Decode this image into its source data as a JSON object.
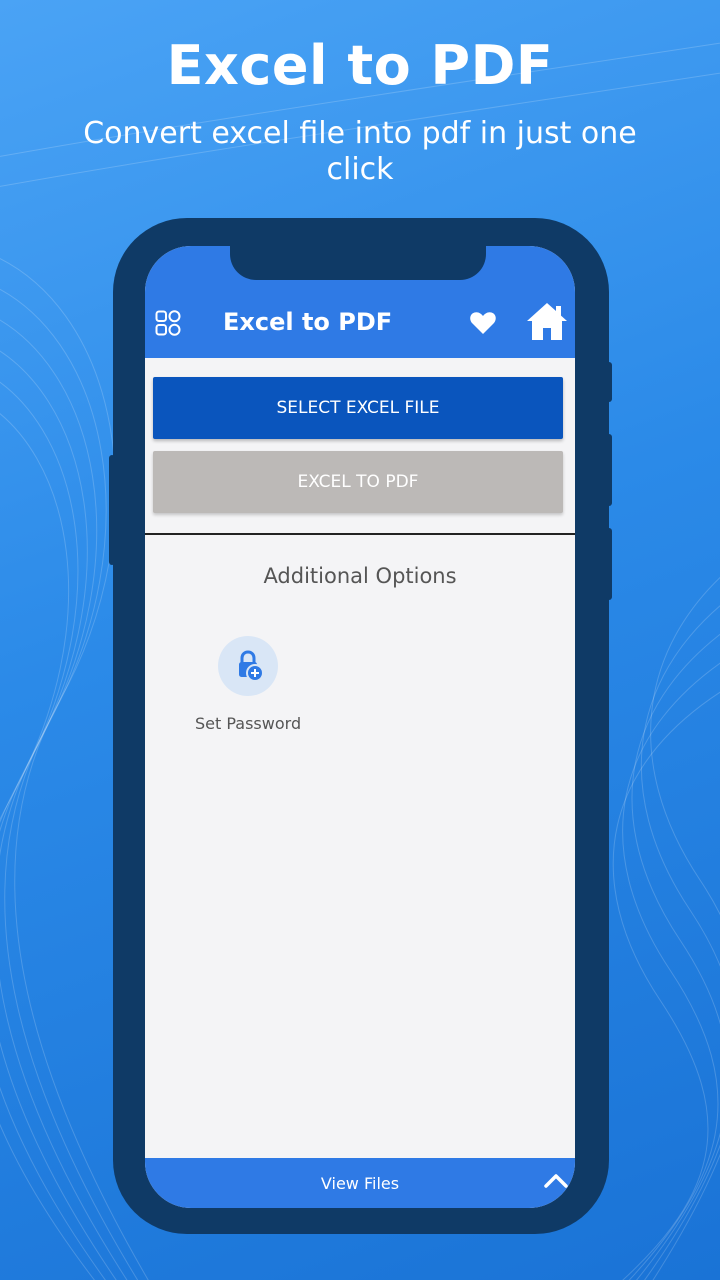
{
  "promo": {
    "headline": "Excel to PDF",
    "subline": "Convert excel file into pdf in just one click"
  },
  "app": {
    "title": "Excel to PDF",
    "icons": {
      "menu": "grid-menu-icon",
      "favorite": "heart-icon",
      "home": "home-icon"
    }
  },
  "actions": {
    "select_label": "SELECT EXCEL FILE",
    "convert_label": "EXCEL TO PDF"
  },
  "additional": {
    "title": "Additional Options",
    "options": [
      {
        "label": "Set Password",
        "icon": "lock-add-icon"
      }
    ]
  },
  "bottom": {
    "label": "View Files",
    "icon": "chevron-up-icon"
  },
  "colors": {
    "primary": "#2f7ae5",
    "select_button": "#0a55bd",
    "convert_button_disabled": "#bcb9b7",
    "phone_frame": "#0f3a66"
  }
}
